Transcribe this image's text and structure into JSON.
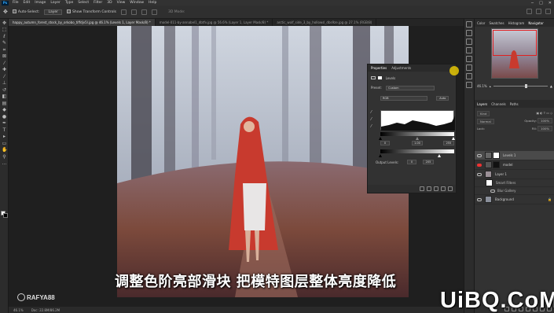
{
  "menubar": {
    "logo": "Ps",
    "items": [
      "File",
      "Edit",
      "Image",
      "Layer",
      "Type",
      "Select",
      "Filter",
      "3D",
      "View",
      "Window",
      "Help"
    ],
    "window_controls": [
      "─",
      "□",
      "✕"
    ]
  },
  "optionsbar": {
    "auto_select_label": "Auto-Select:",
    "auto_select_value": "Layer",
    "show_transform_label": "Show Transform Controls",
    "mode_label": "3D Mode:"
  },
  "tabs": [
    {
      "label": "happy_autumn_forest_stock_by_orkobo_tiffdjv5l.jpg @ 46.1% (Levels 1, Layer Mask/8) *",
      "active": true
    },
    {
      "label": "model-011-by-annabel1_dbtfv.jpg @ 56.6% (Layer 1, Layer Mask/8) *",
      "active": false
    },
    {
      "label": "arctic_wolf_side_3_by_hollowsl_dbs9ze.jpg @ 27.1% (RGB/8)",
      "active": false
    }
  ],
  "subtitle": "调整色阶亮部滑块 把模特图层整体亮度降低",
  "watermark_left": "RAFYA88",
  "watermark_right": "UiBQ.CoM",
  "status": {
    "zoom": "46.1%",
    "doc": "Doc: 22.8M/86.2M"
  },
  "properties": {
    "tabs": [
      "Properties",
      "Adjustments"
    ],
    "title": "Levels",
    "preset_label": "Preset:",
    "preset_value": "Custom",
    "channel_value": "RGB",
    "auto_label": "Auto",
    "input_black": "0",
    "input_mid": "1.00",
    "input_white": "255",
    "output_label": "Output Levels:",
    "output_black": "0",
    "output_white": "205"
  },
  "right_panel": {
    "top_tabs": [
      "Color",
      "Swatches",
      "Histogram",
      "Navigator"
    ],
    "nav_zoom": "46.1%",
    "layer_tabs": [
      "Layers",
      "Channels",
      "Paths"
    ],
    "kind_label": "Kind",
    "blend_mode": "Normal",
    "opacity_label": "Opacity:",
    "opacity": "100%",
    "lock_label": "Lock:",
    "fill_label": "Fill:",
    "fill": "100%",
    "layers": [
      {
        "name": "Levels 1",
        "selected": true,
        "sub": false,
        "mask": true
      },
      {
        "name": "model",
        "selected": false,
        "sub": false,
        "mask": false,
        "eye_red": true
      },
      {
        "name": "Layer 1",
        "selected": false,
        "sub": false,
        "mask": false
      },
      {
        "name": "Smart Filters",
        "selected": false,
        "sub": true,
        "mask": false
      },
      {
        "name": "Blur Gallery",
        "selected": false,
        "sub": true,
        "mask": false
      },
      {
        "name": "Background",
        "selected": false,
        "sub": false,
        "mask": false
      }
    ]
  },
  "colors": {
    "accent_red": "#e02020",
    "cloak": "#c83a2e"
  }
}
